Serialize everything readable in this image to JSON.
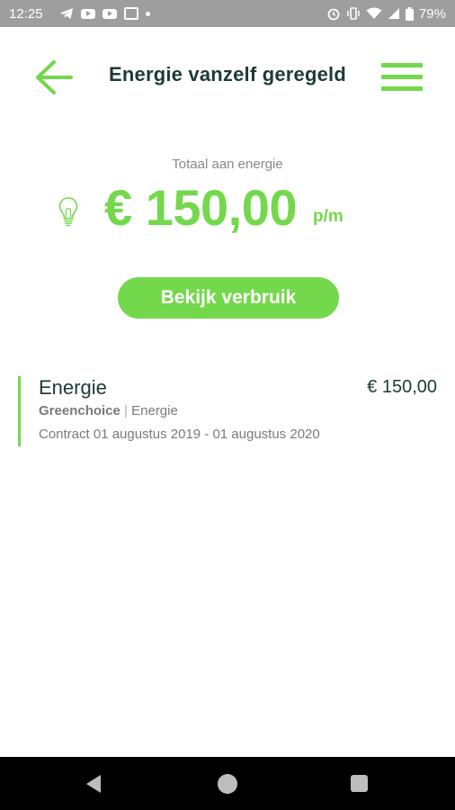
{
  "status_bar": {
    "time": "12:25",
    "battery": "79%",
    "icons": [
      "telegram-icon",
      "youtube-icon",
      "youtube-icon",
      "image-icon",
      "dot-icon",
      "alarm-icon",
      "vibrate-icon",
      "wifi-icon",
      "signal-icon",
      "battery-icon"
    ]
  },
  "header": {
    "title": "Energie vanzelf geregeld",
    "back_icon": "arrow-left-icon",
    "menu_icon": "hamburger-menu-icon"
  },
  "summary": {
    "label": "Totaal aan energie",
    "amount": "€ 150,00",
    "unit": "p/m",
    "icon": "lightbulb-icon"
  },
  "actions": {
    "view_usage_label": "Bekijk verbruik"
  },
  "contracts": [
    {
      "name": "Energie",
      "price": "€ 150,00",
      "supplier": "Greenchoice",
      "separator": "|",
      "category": "Energie",
      "period": "Contract 01 augustus 2019 - 01 augustus 2020"
    }
  ],
  "colors": {
    "accent": "#74d84c",
    "text_dark": "#1e3a36",
    "text_muted": "#7a7a7a",
    "status_bar": "#9e9e9e",
    "nav_bar": "#000000"
  }
}
